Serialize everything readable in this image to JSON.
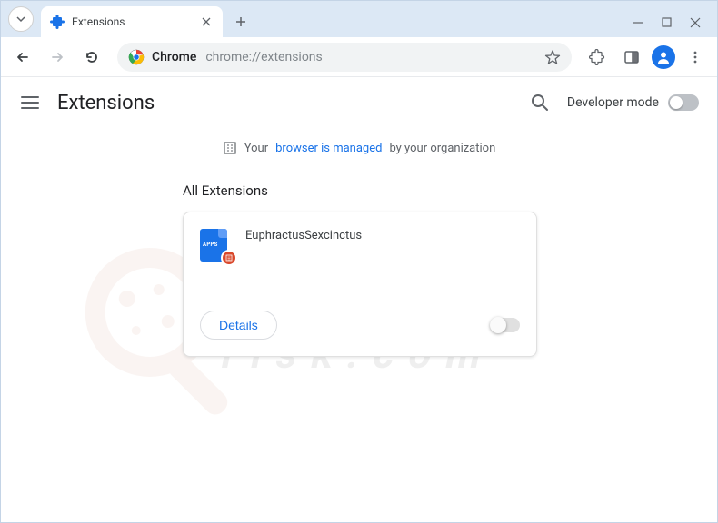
{
  "tab": {
    "title": "Extensions"
  },
  "omnibox": {
    "prefix": "Chrome",
    "url": "chrome://extensions"
  },
  "header": {
    "title": "Extensions",
    "dev_mode_label": "Developer mode"
  },
  "managed_banner": {
    "pre": "Your",
    "link": "browser is managed",
    "post": "by your organization"
  },
  "section": {
    "title": "All Extensions"
  },
  "extension": {
    "name": "EuphractusSexcinctus",
    "icon_text": "APPS",
    "details_label": "Details",
    "enabled": false
  },
  "dev_mode_enabled": false
}
